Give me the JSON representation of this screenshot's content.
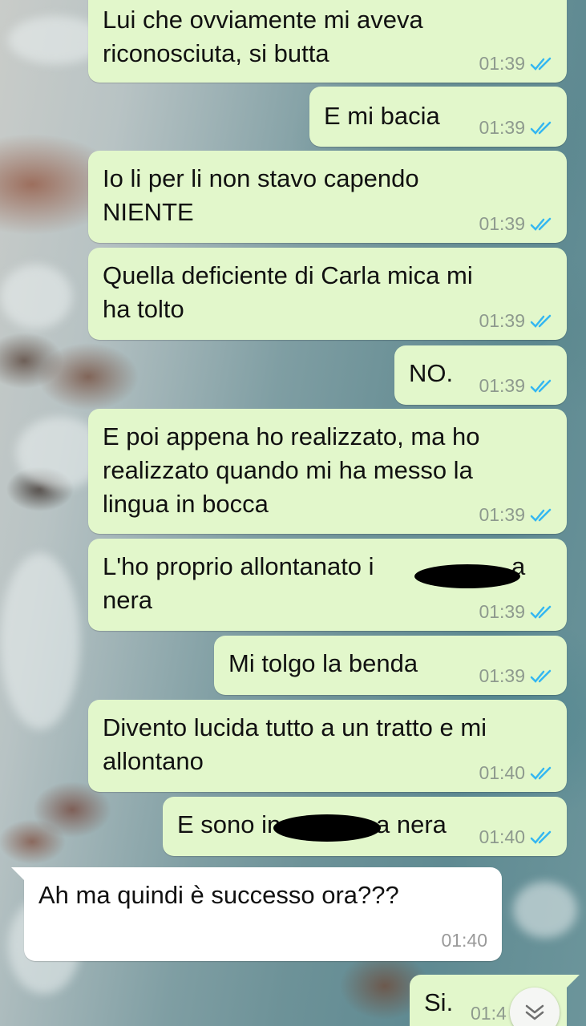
{
  "colors": {
    "outgoing_bubble": "#e2f7cb",
    "incoming_bubble": "#ffffff",
    "read_tick": "#34b7f1",
    "time_text": "#8e9a8e"
  },
  "messages": [
    {
      "direction": "out",
      "lines": [
        "Lui che ovviamente mi aveva",
        "riconosciuta, si butta"
      ],
      "time": "01:39",
      "status": "read"
    },
    {
      "direction": "out",
      "lines": [
        "E mi bacia"
      ],
      "time": "01:39",
      "status": "read"
    },
    {
      "direction": "out",
      "lines": [
        "Io li per li non stavo capendo",
        "NIENTE"
      ],
      "time": "01:39",
      "status": "read"
    },
    {
      "direction": "out",
      "lines": [
        "Quella deficiente di Carla mica mi",
        "ha tolto"
      ],
      "time": "01:39",
      "status": "read"
    },
    {
      "direction": "out",
      "lines": [
        "NO."
      ],
      "time": "01:39",
      "status": "read"
    },
    {
      "direction": "out",
      "lines": [
        "E poi appena ho realizzato, ma ho",
        "realizzato quando mi ha messo la",
        "lingua in bocca"
      ],
      "time": "01:39",
      "status": "read"
    },
    {
      "direction": "out",
      "lines": [
        "L'ho proprio allontanato i",
        "nera"
      ],
      "line1_suffix": "a",
      "redacted": true,
      "time": "01:39",
      "status": "read"
    },
    {
      "direction": "out",
      "lines": [
        "Mi tolgo la benda"
      ],
      "time": "01:39",
      "status": "read"
    },
    {
      "direction": "out",
      "lines": [
        "Divento lucida tutto a un tratto e mi",
        "allontano"
      ],
      "time": "01:40",
      "status": "read"
    },
    {
      "direction": "out",
      "lines": [
        "E sono in"
      ],
      "line1_suffix": "a nera",
      "redacted": true,
      "time": "01:40",
      "status": "read"
    },
    {
      "direction": "in",
      "lines": [
        "Ah ma quindi è successo ora???"
      ],
      "time": "01:40"
    },
    {
      "direction": "out",
      "lines": [
        "Si."
      ],
      "time": "01:4",
      "status": "read"
    }
  ],
  "scroll_button": {
    "icon": "double-chevron-down-icon"
  }
}
